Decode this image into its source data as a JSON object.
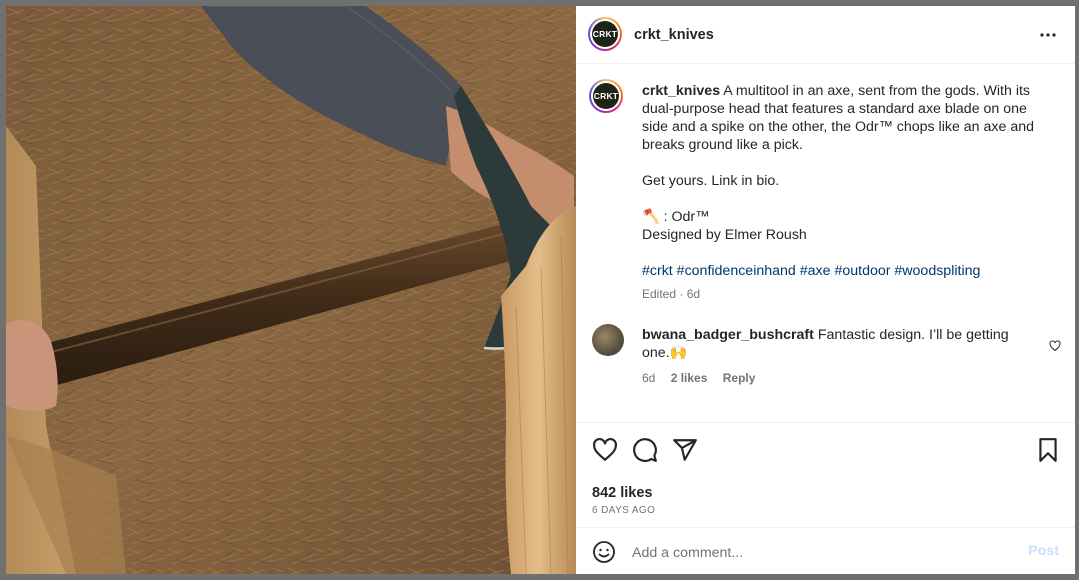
{
  "post": {
    "account": {
      "username": "crkt_knives",
      "avatar_text": "CRKT"
    },
    "caption": {
      "username": "crkt_knives",
      "text": "A multitool in an axe, sent from the gods. With its dual-purpose head that features a standard axe blade on one side and a spike on the other, the Odr™ chops like an axe and breaks ground like a pick.",
      "line2": "Get yours. Link in bio.",
      "line3_emoji": "🪓",
      "line3": " : Odr™",
      "line4": "Designed by Elmer Roush",
      "hashtags": "#crkt #confidenceinhand #axe #outdoor #woodspliting",
      "edited": "Edited · 6d"
    },
    "comment": {
      "username": "bwana_badger_bushcraft",
      "text": "Fantastic design. I’ll be getting one.🙌",
      "age": "6d",
      "likes": "2 likes",
      "reply": "Reply"
    },
    "likes": "842 likes",
    "time_ago": "6 DAYS AGO",
    "comment_input": {
      "placeholder": "Add a comment...",
      "post_label": "Post"
    }
  },
  "icons": {
    "more": "more-options-icon",
    "heart": "heart-icon",
    "comment": "comment-icon",
    "share": "share-icon",
    "save": "bookmark-icon",
    "emoji": "emoji-icon"
  },
  "colors": {
    "text": "#262626",
    "muted": "#737373",
    "hashtag": "#00376b",
    "post_disabled": "#c7e0fd",
    "avatar_bg": "#1e2418"
  }
}
